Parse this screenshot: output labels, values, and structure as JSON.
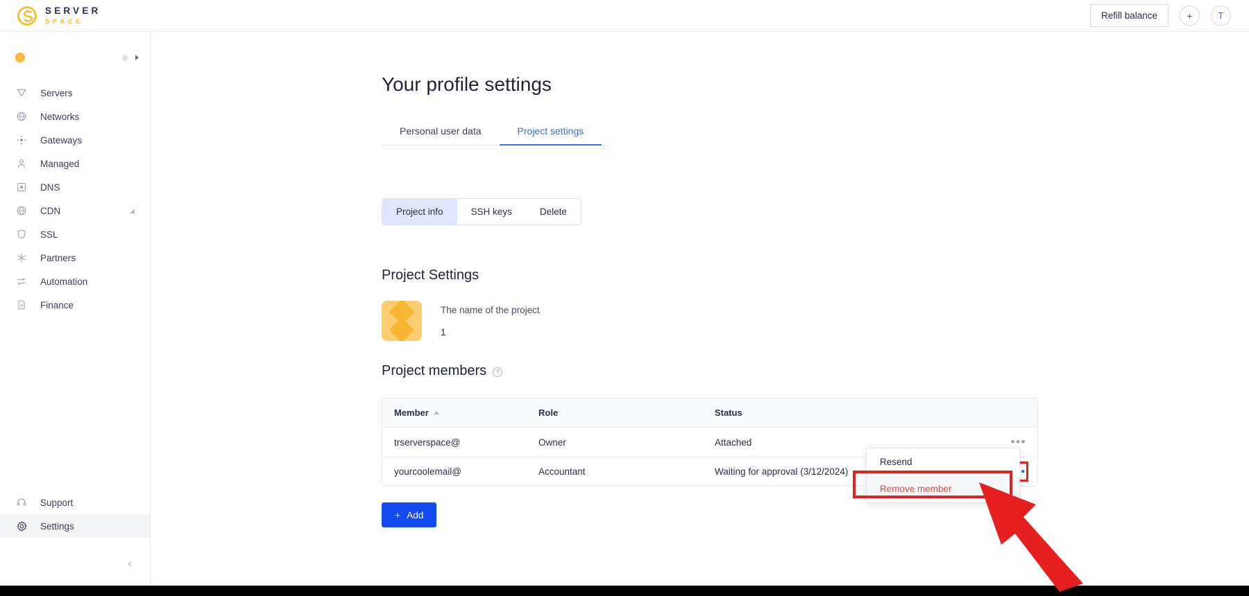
{
  "brand": {
    "top": "SERVER",
    "bottom": "SPACE",
    "logo_icon": "serverspace-s-logo-icon"
  },
  "topbar": {
    "refill_label": "Refill balance",
    "add_icon": "plus-icon",
    "avatar_letter": "T"
  },
  "sidebar": {
    "project_switcher": {
      "dot_icon": "project-color-dot-icon",
      "gear_icon": "gear-icon",
      "caret_icon": "caret-right-icon"
    },
    "items": [
      {
        "label": "Servers",
        "icon": "servers-icon",
        "active": false,
        "expandable": false
      },
      {
        "label": "Networks",
        "icon": "network-globe-icon",
        "active": false,
        "expandable": false
      },
      {
        "label": "Gateways",
        "icon": "gateways-icon",
        "active": false,
        "expandable": false
      },
      {
        "label": "Managed",
        "icon": "managed-user-icon",
        "active": false,
        "expandable": false
      },
      {
        "label": "DNS",
        "icon": "dns-icon",
        "active": false,
        "expandable": false
      },
      {
        "label": "CDN",
        "icon": "cdn-globe-icon",
        "active": false,
        "expandable": true
      },
      {
        "label": "SSL",
        "icon": "shield-icon",
        "active": false,
        "expandable": false
      },
      {
        "label": "Partners",
        "icon": "partners-icon",
        "active": false,
        "expandable": false
      },
      {
        "label": "Automation",
        "icon": "automation-arrows-icon",
        "active": false,
        "expandable": false
      },
      {
        "label": "Finance",
        "icon": "finance-document-icon",
        "active": false,
        "expandable": false
      }
    ],
    "bottom_items": [
      {
        "label": "Support",
        "icon": "headset-icon",
        "active": false
      },
      {
        "label": "Settings",
        "icon": "gear-icon",
        "active": true
      }
    ],
    "collapse_icon": "chevron-left-icon"
  },
  "main": {
    "page_title": "Your profile settings",
    "tabs": [
      {
        "label": "Personal user data",
        "active": false
      },
      {
        "label": "Project settings",
        "active": true
      }
    ],
    "segmented": [
      {
        "label": "Project info",
        "active": true
      },
      {
        "label": "SSH keys",
        "active": false
      },
      {
        "label": "Delete",
        "active": false
      }
    ],
    "project_settings": {
      "heading": "Project Settings",
      "avatar_icon": "project-diamond-avatar-icon",
      "name_label": "The name of the project",
      "name_value": "1"
    },
    "project_members": {
      "heading": "Project members",
      "help_icon": "question-mark-icon",
      "columns": [
        "Member",
        "Role",
        "Status"
      ],
      "sort_icon": "sort-ascending-icon",
      "rows": [
        {
          "member": "trserverspace@",
          "role": "Owner",
          "status": "Attached",
          "menu_icon": "more-options-icon",
          "highlighted": false
        },
        {
          "member": "yourcoolemail@",
          "role": "Accountant",
          "status": "Waiting for approval (3/12/2024)",
          "menu_icon": "more-options-icon",
          "highlighted": true
        }
      ],
      "add_label": "Add",
      "add_icon": "plus-icon"
    },
    "dropdown": {
      "items": [
        {
          "label": "Resend",
          "danger": false
        },
        {
          "label": "Remove member",
          "danger": true
        }
      ]
    }
  },
  "annotation": {
    "arrow_icon": "red-arrow-pointing-up-left-icon",
    "highlight_color": "#e62020"
  }
}
